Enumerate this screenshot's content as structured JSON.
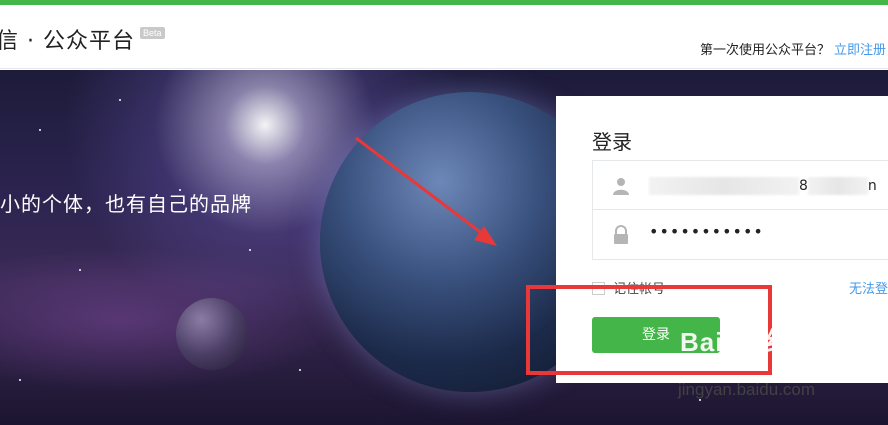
{
  "header": {
    "logo_text": "信 · 公众平台",
    "beta_badge": "Beta",
    "first_use_text": "第一次使用公众平台？",
    "register_link": "立即注册"
  },
  "hero": {
    "slogan": "小的个体，也有自己的品牌"
  },
  "login": {
    "title": "登录",
    "username_value": "8",
    "username_suffix": "n",
    "password_value": "•••••••••••",
    "remember_label": "记住帐号",
    "forgot_link": "无法登",
    "submit_label": "登录"
  },
  "watermark": {
    "brand": "Baidu 经验",
    "url": "jingyan.baidu.com"
  },
  "colors": {
    "accent_green": "#44b549",
    "link_blue": "#459ae9",
    "highlight_red": "#e83838"
  }
}
